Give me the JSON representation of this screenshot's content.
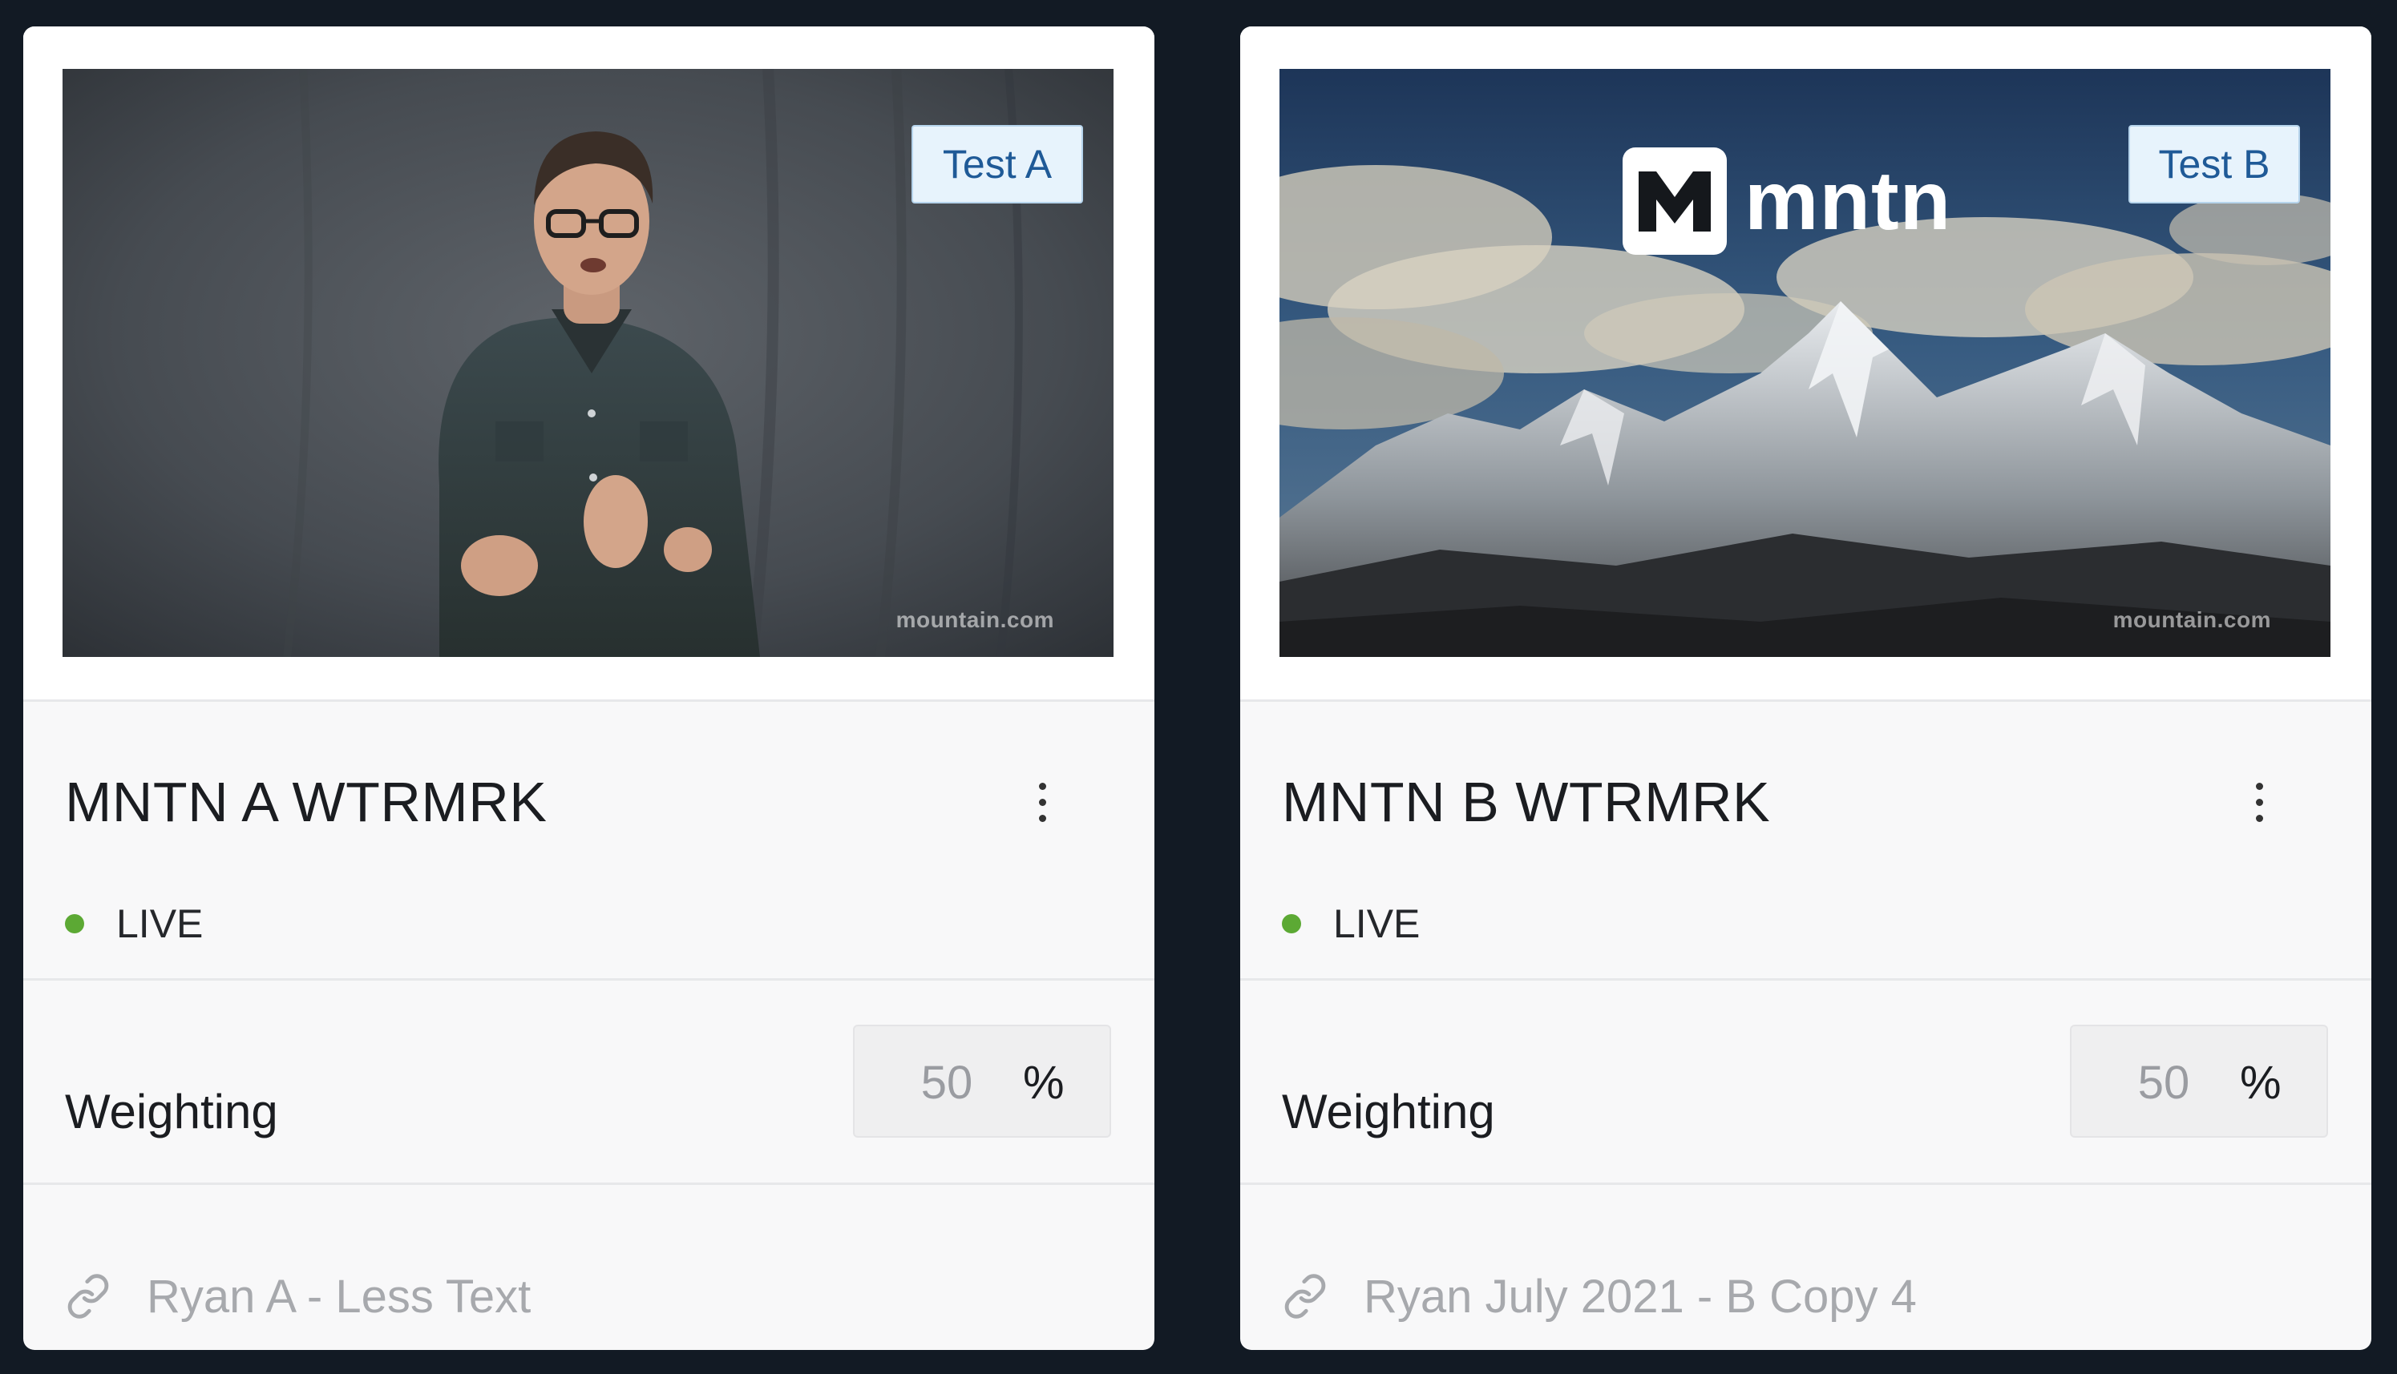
{
  "cards": [
    {
      "badge": "Test A",
      "watermark": "mountain.com",
      "title": "MNTN A WTRMRK",
      "status": "LIVE",
      "weighting_label": "Weighting",
      "weighting_value": "50",
      "weighting_unit": "%",
      "link_text": "Ryan A - Less Text"
    },
    {
      "badge": "Test B",
      "watermark": "mountain.com",
      "logo_text": "mntn",
      "title": "MNTN B WTRMRK",
      "status": "LIVE",
      "weighting_label": "Weighting",
      "weighting_value": "50",
      "weighting_unit": "%",
      "link_text": "Ryan July 2021 - B Copy 4"
    }
  ],
  "colors": {
    "background": "#121a24",
    "card": "#f8f8f9",
    "badge_bg": "#e7f3fc",
    "badge_text": "#1f5a97",
    "live": "#5ca934"
  },
  "icons": {
    "menu": "kebab-menu-icon",
    "link": "link-icon",
    "status": "status-dot-icon"
  }
}
